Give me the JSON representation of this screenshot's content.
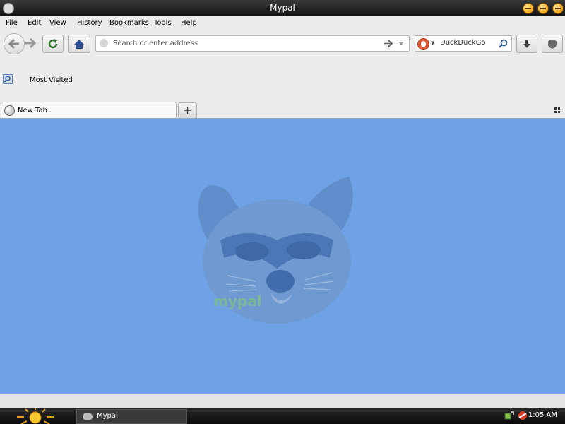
{
  "window": {
    "title": "Mypal"
  },
  "menu": [
    "File",
    "Edit",
    "View",
    "History",
    "Bookmarks",
    "Tools",
    "Help"
  ],
  "address_bar": {
    "placeholder": "Search or enter address"
  },
  "search_bar": {
    "engine": "DuckDuckGo"
  },
  "bookmarks": {
    "most_visited": "Most Visited"
  },
  "tabs": [
    {
      "label": "New Tab"
    }
  ],
  "content": {
    "logo_text": "mypal",
    "background": "#6fa2e4"
  },
  "taskbar": {
    "app": "Mypal",
    "clock": "1:05 AM"
  }
}
